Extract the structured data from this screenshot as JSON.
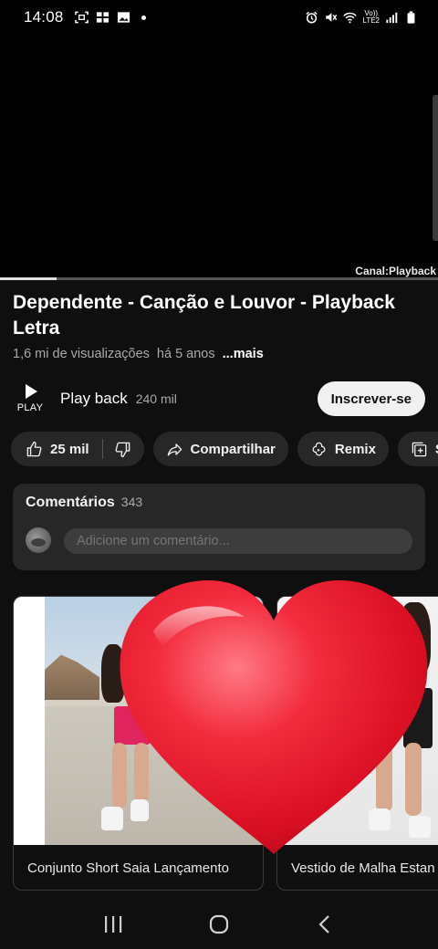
{
  "status_bar": {
    "time": "14:08",
    "network_label_top": "Vo))",
    "network_label_bottom": "LTE2",
    "icons": [
      "screenshot-icon",
      "gallery-icon",
      "image-icon",
      "alarm-icon",
      "mute-icon",
      "wifi-icon",
      "signal-icon",
      "battery-icon"
    ]
  },
  "player": {
    "watermark": "Canal:Playback",
    "progress_fraction": 0.13
  },
  "video": {
    "title": "Dependente - Canção e Louvor - Playback Letra",
    "views": "1,6 mi de visualizações",
    "age": "há 5 anos",
    "more_label": "...mais"
  },
  "channel": {
    "avatar_text": "PLAY",
    "name": "Play back",
    "subscribers": "240 mil",
    "subscribe_label": "Inscrever-se"
  },
  "actions": {
    "like_count": "25 mil",
    "share_label": "Compartilhar",
    "remix_label": "Remix",
    "save_label": "Sa"
  },
  "comments": {
    "title": "Comentários",
    "count": "343",
    "placeholder": "Adicione um comentário..."
  },
  "products": [
    {
      "caption": "Conjunto Short Saia Lançamento"
    },
    {
      "caption": "Vestido de Malha Estan"
    }
  ],
  "colors": {
    "background": "#0f0f0f",
    "chip": "#272727",
    "heart": "#e8132a"
  }
}
